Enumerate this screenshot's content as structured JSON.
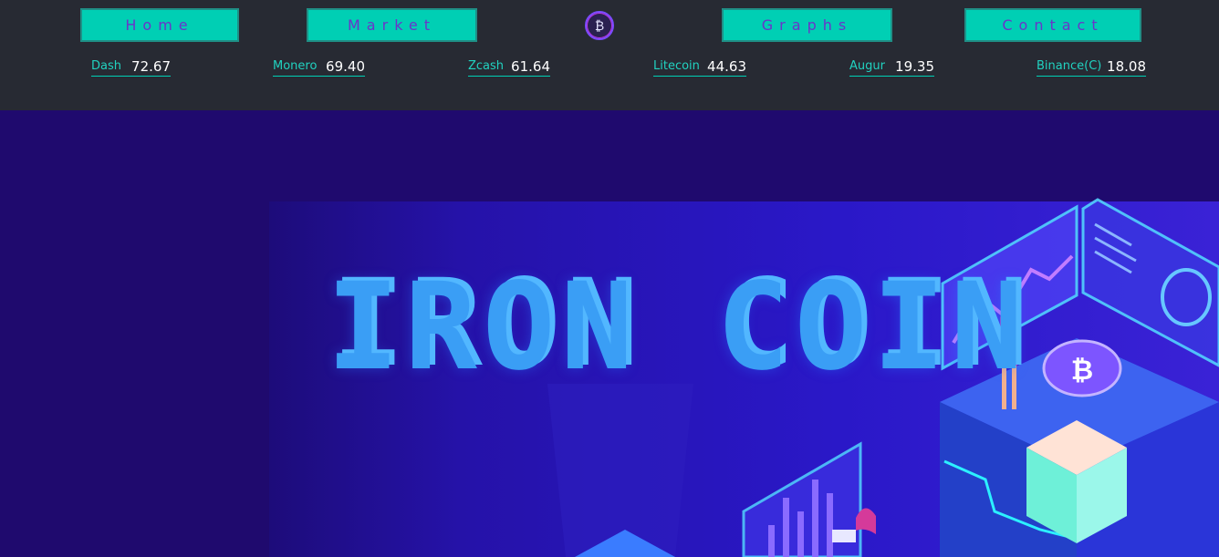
{
  "nav": {
    "home": "Home",
    "market": "Market",
    "graphs": "Graphs",
    "contact": "Contact"
  },
  "logo": {
    "icon": "bitcoin-icon"
  },
  "tickers": [
    {
      "name": "Dash",
      "value": "72.67"
    },
    {
      "name": "Monero",
      "value": "69.40"
    },
    {
      "name": "Zcash",
      "value": "61.64"
    },
    {
      "name": "Litecoin",
      "value": "44.63"
    },
    {
      "name": "Augur",
      "value": "19.35"
    },
    {
      "name": "Binance(C)",
      "value": "18.08"
    }
  ],
  "hero": {
    "title": "IRON COIN"
  },
  "colors": {
    "header_bg": "#272a33",
    "button_bg": "#00cfb4",
    "button_text": "#6a35c9",
    "ticker_name": "#21d2c0",
    "hero_bg": "#1f0a6e",
    "title": "#3a9ef5"
  }
}
